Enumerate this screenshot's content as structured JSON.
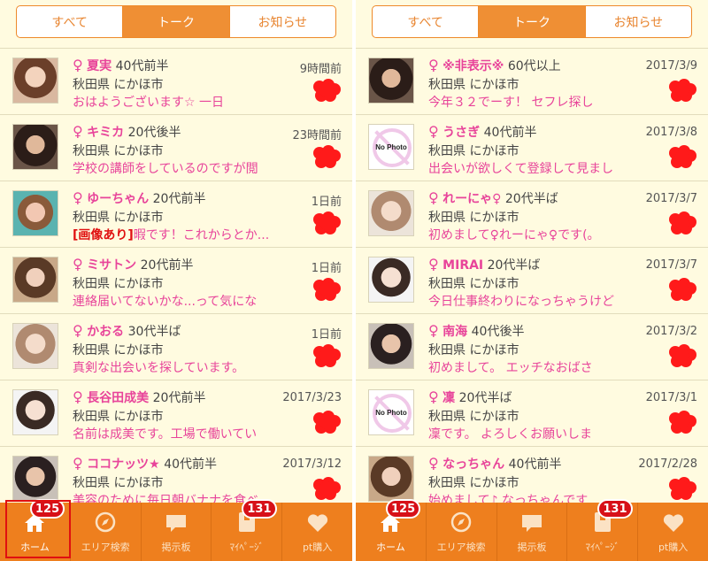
{
  "left": {
    "tabs": [
      "すべて",
      "トーク",
      "お知らせ"
    ],
    "active_tab": 1,
    "rows": [
      {
        "name": "夏実",
        "age": "40代前半",
        "location": "秋田県 にかほ市",
        "tag": "",
        "message": "おはようございます☆ 一日",
        "time": "9時間前",
        "avatar": "photo-warm"
      },
      {
        "name": "キミカ",
        "age": "20代後半",
        "location": "秋田県 にかほ市",
        "tag": "",
        "message": "学校の講師をしているのですが閲",
        "time": "23時間前",
        "avatar": "photo-dark"
      },
      {
        "name": "ゆーちゃん",
        "age": "20代前半",
        "location": "秋田県 にかほ市",
        "tag": "[画像あり]",
        "message": "暇です！これからとか...",
        "time": "1日前",
        "avatar": "photo-teal"
      },
      {
        "name": "ミサトン",
        "age": "20代前半",
        "location": "秋田県 にかほ市",
        "tag": "",
        "message": "連絡届いてないかな...って気にな",
        "time": "1日前",
        "avatar": "photo-brown"
      },
      {
        "name": "かおる",
        "age": "30代半ば",
        "location": "秋田県 にかほ市",
        "tag": "",
        "message": "真剣な出会いを探しています。",
        "time": "1日前",
        "avatar": "photo-light"
      },
      {
        "name": "長谷田成美",
        "age": "20代前半",
        "location": "秋田県 にかほ市",
        "tag": "",
        "message": "名前は成美です。工場で働いてい",
        "time": "2017/3/23",
        "avatar": "photo-white"
      },
      {
        "name": "ココナッツ★",
        "age": "40代前半",
        "location": "秋田県 にかほ市",
        "tag": "",
        "message": "美容のために毎日朝バナナを食べ",
        "time": "2017/3/12",
        "avatar": "photo-glasses"
      }
    ]
  },
  "right": {
    "tabs": [
      "すべて",
      "トーク",
      "お知らせ"
    ],
    "active_tab": 1,
    "rows": [
      {
        "name": "※非表示※",
        "age": "60代以上",
        "location": "秋田県 にかほ市",
        "tag": "",
        "message": "今年３２でーす！ セフレ探し",
        "time": "2017/3/9",
        "avatar": "photo-dark"
      },
      {
        "name": "うさぎ",
        "age": "40代前半",
        "location": "秋田県 にかほ市",
        "tag": "",
        "message": "出会いが欲しくて登録して見まし",
        "time": "2017/3/8",
        "avatar": "nophoto"
      },
      {
        "name": "れーにゃ♀",
        "age": "20代半ば",
        "location": "秋田県 にかほ市",
        "tag": "",
        "message": "初めまして♀れーにゃ♀です(。",
        "time": "2017/3/7",
        "avatar": "photo-light"
      },
      {
        "name": "MIRAI",
        "age": "20代半ば",
        "location": "秋田県 にかほ市",
        "tag": "",
        "message": "今日仕事終わりになっちゃうけど",
        "time": "2017/3/7",
        "avatar": "photo-white"
      },
      {
        "name": "南海",
        "age": "40代後半",
        "location": "秋田県 にかほ市",
        "tag": "",
        "message": "初めまして。 エッチなおばさ",
        "time": "2017/3/2",
        "avatar": "photo-glasses"
      },
      {
        "name": "凜",
        "age": "20代半ば",
        "location": "秋田県 にかほ市",
        "tag": "",
        "message": "凜です。 よろしくお願いしま",
        "time": "2017/3/1",
        "avatar": "nophoto"
      },
      {
        "name": "なっちゃん",
        "age": "40代前半",
        "location": "秋田県 にかほ市",
        "tag": "",
        "message": "始めまして♪ なっちゃんです",
        "time": "2017/2/28",
        "avatar": "photo-brown"
      }
    ]
  },
  "nophoto_label": "No Photo",
  "gender_symbol": "♀",
  "bottom_nav": [
    {
      "label": "ホーム",
      "icon": "home-icon",
      "badge": "125"
    },
    {
      "label": "エリア検索",
      "icon": "compass-icon",
      "badge": ""
    },
    {
      "label": "掲示板",
      "icon": "chat-bubble-icon",
      "badge": ""
    },
    {
      "label": "ﾏｲﾍﾟｰｼﾞ",
      "icon": "mypage-icon",
      "badge": "131"
    },
    {
      "label": "pt購入",
      "icon": "heart-icon",
      "badge": ""
    }
  ],
  "colors": {
    "accent": "#ee7f1e",
    "pink": "#e8449a",
    "background": "#fffbe0",
    "badge": "#d71018"
  }
}
